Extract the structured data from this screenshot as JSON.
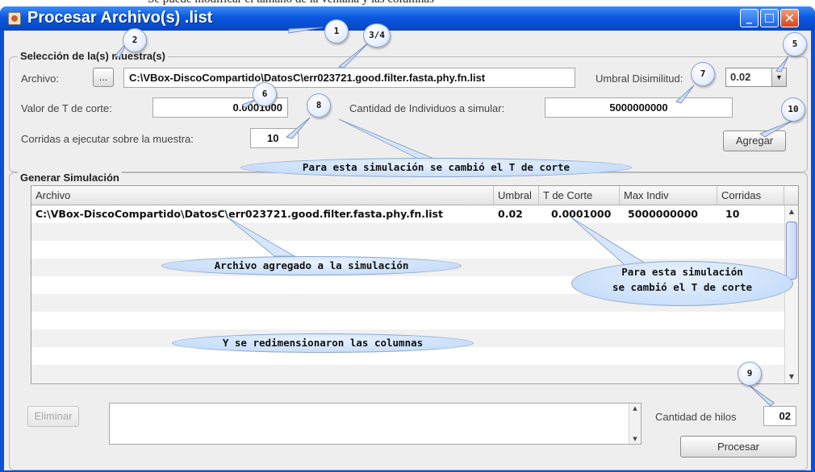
{
  "background_caption": "Se puede modificar el tamaño de la ventana y las columnas",
  "window": {
    "title": "Procesar Archivo(s)  .list",
    "min_symbol": "_",
    "max_symbol": "□",
    "close_symbol": "✕"
  },
  "seleccion": {
    "group_title": "Selección de la(s) muestra(s)",
    "archivo_label": "Archivo:",
    "browse_label": "...",
    "archivo_value": "C:\\VBox-DiscoCompartido\\DatosC\\err023721.good.filter.fasta.phy.fn.list",
    "umbral_label": "Umbral Disimilitud:",
    "umbral_value": "0.02",
    "tcorte_label": "Valor de T de corte:",
    "tcorte_value": "0.0001000",
    "individuos_label": "Cantidad de Individuos a simular:",
    "individuos_value": "5000000000",
    "corridas_label": "Corridas a ejecutar sobre la muestra:",
    "corridas_value": "10",
    "agregar_label": "Agregar"
  },
  "simulacion": {
    "group_title": "Generar Simulación",
    "columns": [
      "Archivo",
      "Umbral",
      "T de Corte",
      "Max Indiv",
      "Corridas"
    ],
    "rows": [
      {
        "archivo": "C:\\VBox-DiscoCompartido\\DatosC\\err023721.good.filter.fasta.phy.fn.list",
        "umbral": "0.02",
        "tcorte": "0.0001000",
        "maxindiv": "5000000000",
        "corridas": "10"
      }
    ],
    "eliminar_label": "Eliminar",
    "hilos_label": "Cantidad de hilos",
    "hilos_value": "02",
    "procesar_label": "Procesar"
  },
  "annotations": {
    "markers": [
      "1",
      "2",
      "3/4",
      "5",
      "6",
      "7",
      "8",
      "9",
      "10"
    ],
    "bubble_tcorte_top": "Para esta simulación se cambió el T de corte",
    "bubble_archivo": "Archivo agregado a la simulación",
    "bubble_tcorte_right_l1": "Para esta simulación",
    "bubble_tcorte_right_l2": "se cambió el T de corte",
    "bubble_columnas": "Y se redimensionaron las columnas"
  }
}
